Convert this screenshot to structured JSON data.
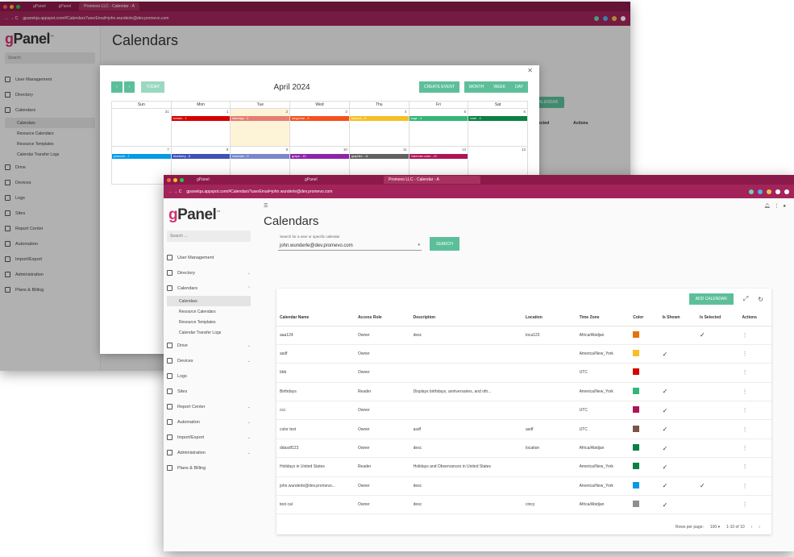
{
  "back": {
    "tabs": [
      "gPanel",
      "gPanel",
      "Promevo LLC - Calendar - A"
    ],
    "address": "gpanelqa.appspot.com/#Calendars?userEmail=john.wunderle@dev.promevo.com",
    "logo": "gPanel",
    "search": "Search",
    "nav": [
      "User Management",
      "Directory",
      "Calendars",
      "Drive",
      "Devices",
      "Logs",
      "Sites",
      "Report Center",
      "Automation",
      "Import/Export",
      "Administration",
      "Plans & Billing"
    ],
    "sub": [
      "Calendars",
      "Resource Calendars",
      "Resource Templates",
      "Calendar Transfer Logs"
    ],
    "page_title": "Calendars",
    "add_calendar": "ADD CALENDAR",
    "headers": [
      "Is Selected",
      "Actions"
    ],
    "modal": {
      "today": "TODAY",
      "title": "April 2024",
      "create": "CREATE EVENT",
      "month": "MONTH",
      "week": "WEEK",
      "day": "DAY",
      "dow": [
        "Sun",
        "Mon",
        "Tue",
        "Wed",
        "Thu",
        "Fri",
        "Sat"
      ],
      "week1": [
        "31",
        "1",
        "2",
        "3",
        "4",
        "5",
        "6"
      ],
      "week2": [
        "7",
        "8",
        "9",
        "10",
        "11",
        "12",
        "13"
      ],
      "ev1": [
        "tomato - 1",
        "flamingo - 3",
        "tangerine - 3",
        "banana - 3",
        "sage - 3",
        "basil - 4"
      ],
      "ev2": [
        "peacock - 7",
        "blueberry - 8",
        "lavender - 9",
        "grape - 10",
        "graphite - 11",
        "Calendar color - 12"
      ]
    }
  },
  "front": {
    "tabs": [
      "gPanel",
      "gPanel",
      "Promevo LLC - Calendar - A"
    ],
    "address": "gpanelqa.appspot.com/#Calendars?userEmail=john.wunderle@dev.promevo.com",
    "logo": "gPanel",
    "search": "Search ...",
    "nav": {
      "user_management": "User Management",
      "directory": "Directory",
      "calendars": "Calendars",
      "drive": "Drive",
      "devices": "Devices",
      "logs": "Logs",
      "sites": "Sites",
      "report_center": "Report Center",
      "automation": "Automation",
      "import_export": "Import/Export",
      "administration": "Administration",
      "plans_billing": "Plans & Billing"
    },
    "sub": [
      "Calendars",
      "Resource Calendars",
      "Resource Templates",
      "Calendar Transfer Logs"
    ],
    "page_title": "Calendars",
    "search_label": "Search for a user or specific calendar",
    "search_value": "john.wunderle@dev.promevo.com",
    "search_button": "SEARCH",
    "add_calendar": "ADD CALENDAR",
    "columns": [
      "Calendar Name",
      "Access Role",
      "Description",
      "Location",
      "Time Zone",
      "Color",
      "Is Shown",
      "Is Selected",
      "Actions"
    ],
    "rows": [
      {
        "name": "aaa124",
        "role": "Owner",
        "desc": "desc",
        "loc": "loca123",
        "tz": "Africa/Abidjan",
        "color": "#e8710a",
        "shown": false,
        "selected": true
      },
      {
        "name": "asdf",
        "role": "Owner",
        "desc": "",
        "loc": "",
        "tz": "America/New_York",
        "color": "#f6bf26",
        "shown": true,
        "selected": false
      },
      {
        "name": "bbb",
        "role": "Owner",
        "desc": "",
        "loc": "",
        "tz": "UTC",
        "color": "#d50000",
        "shown": false,
        "selected": false
      },
      {
        "name": "Birthdays",
        "role": "Reader",
        "desc": "Displays birthdays, anniversaries, and oth...",
        "loc": "",
        "tz": "America/New_York",
        "color": "#33b679",
        "shown": true,
        "selected": false
      },
      {
        "name": "ccc",
        "role": "Owner",
        "desc": "",
        "loc": "",
        "tz": "UTC",
        "color": "#ad1457",
        "shown": true,
        "selected": false
      },
      {
        "name": "color test",
        "role": "Owner",
        "desc": "asdf",
        "loc": "asdf",
        "tz": "UTC",
        "color": "#795548",
        "shown": true,
        "selected": false
      },
      {
        "name": "ddasdf123",
        "role": "Owner",
        "desc": "desc",
        "loc": "location",
        "tz": "Africa/Abidjan",
        "color": "#0b8043",
        "shown": true,
        "selected": false
      },
      {
        "name": "Holidays in United States",
        "role": "Reader",
        "desc": "Holidays and Observances in United States",
        "loc": "",
        "tz": "America/New_York",
        "color": "#0b8043",
        "shown": true,
        "selected": false
      },
      {
        "name": "john.wunderle@dev.promevo...",
        "role": "Owner",
        "desc": "desc",
        "loc": "",
        "tz": "America/New_York",
        "color": "#039be5",
        "shown": true,
        "selected": true
      },
      {
        "name": "test cal",
        "role": "Owner",
        "desc": "desc",
        "loc": "cincy",
        "tz": "Africa/Abidjan",
        "color": "#8e8e8e",
        "shown": true,
        "selected": false
      }
    ],
    "rows_per_page_label": "Rows per page:",
    "rows_per_page": "100",
    "range": "1-10 of 10"
  },
  "icons": {
    "check": "✓",
    "kebab": "⋮",
    "chevron": "⌄"
  }
}
